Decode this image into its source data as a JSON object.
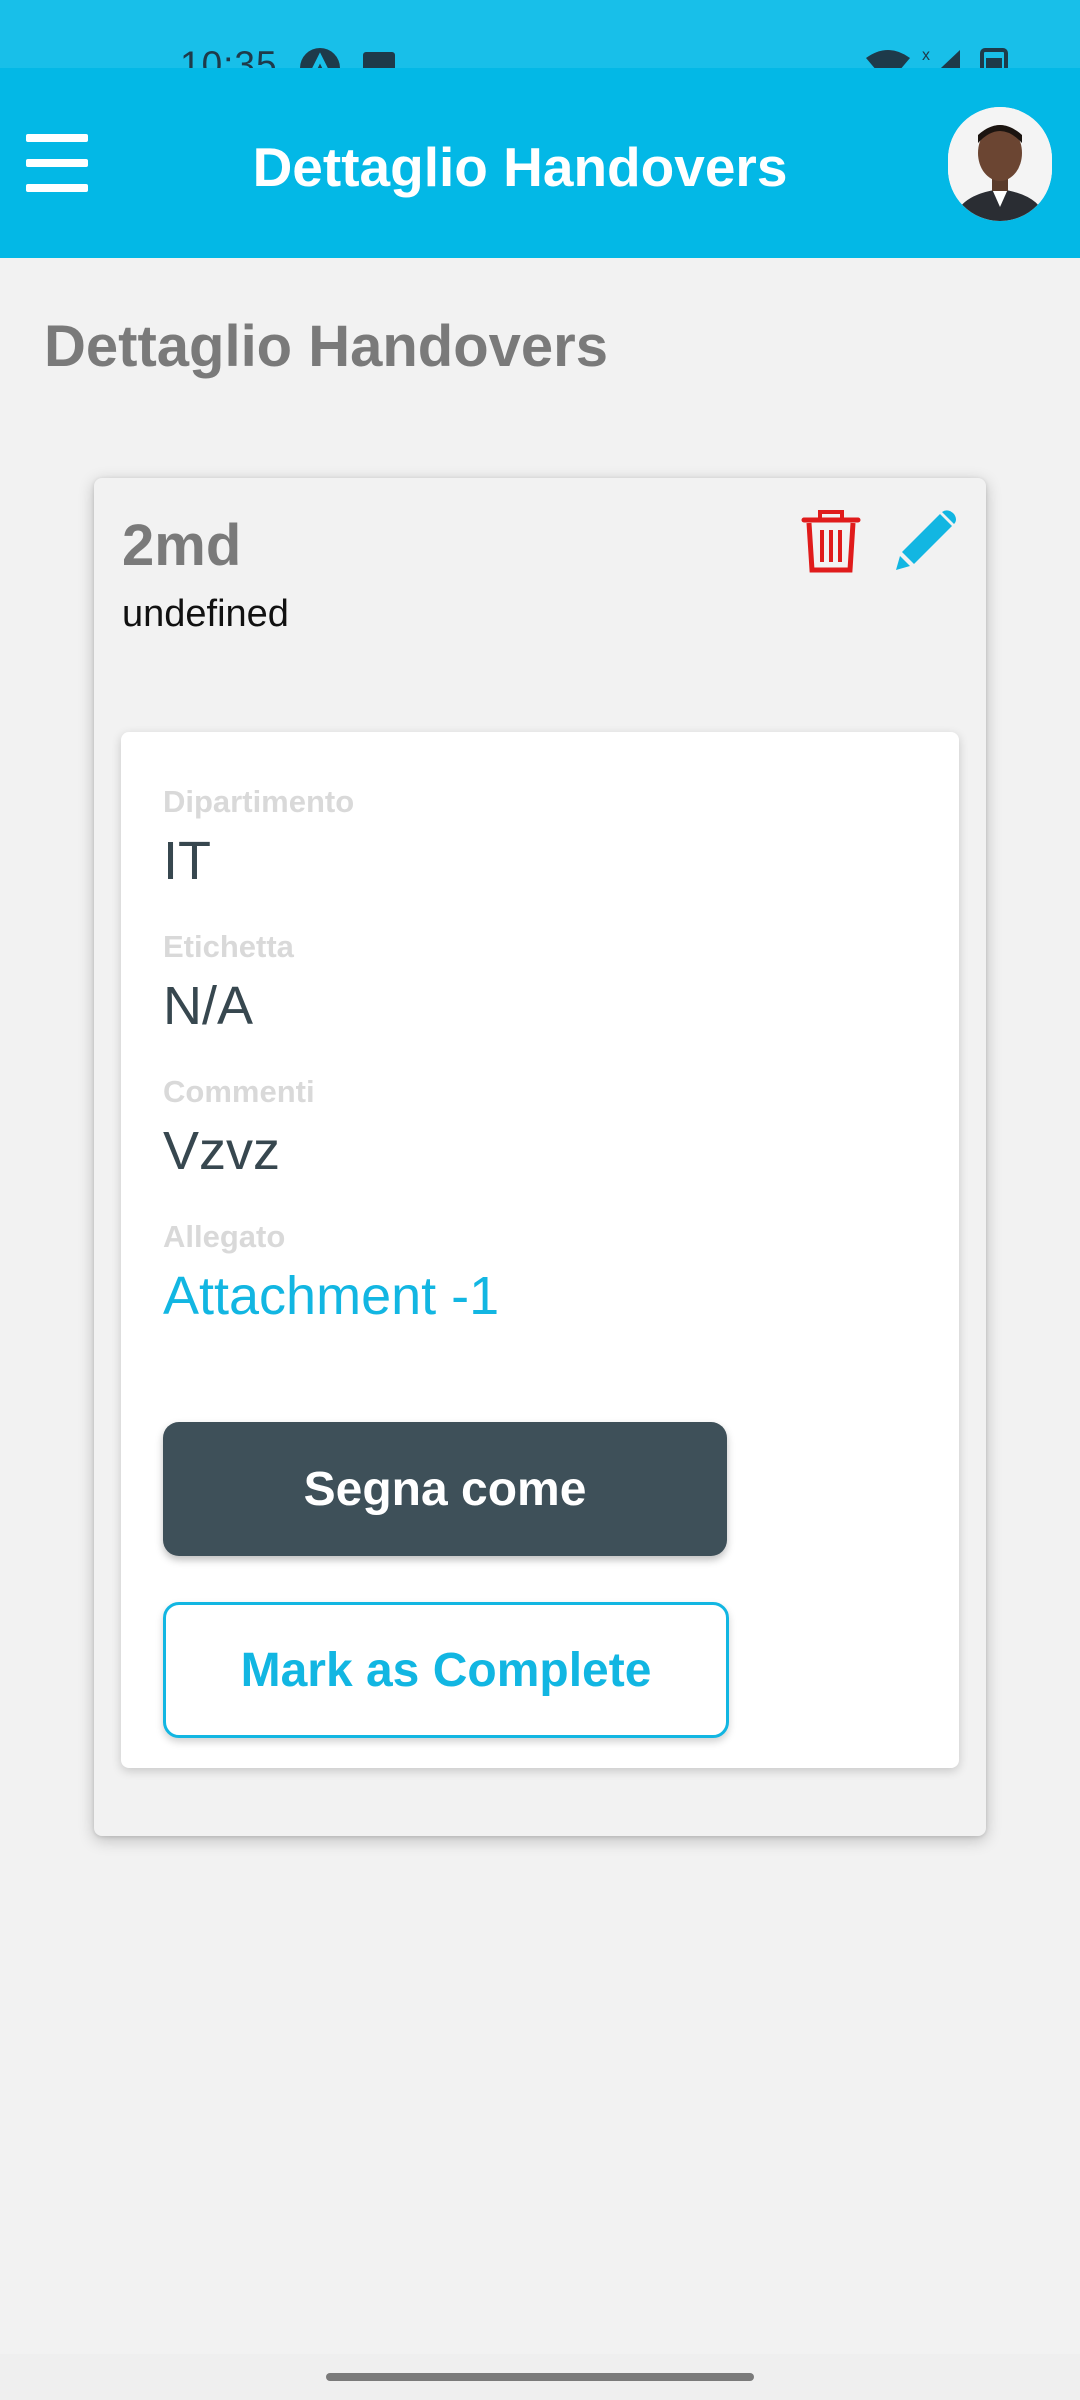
{
  "status_bar": {
    "time": "10:35",
    "icons": [
      "app-notification-icon",
      "image-notification-icon",
      "wifi-icon",
      "signal-icon",
      "battery-icon"
    ]
  },
  "app_bar": {
    "title": "Dettaglio Handovers",
    "menu_icon": "hamburger-menu-icon",
    "avatar": "user-avatar"
  },
  "page": {
    "title": "Dettaglio Handovers"
  },
  "handover": {
    "name": "2md",
    "subtitle": "undefined",
    "fields": [
      {
        "label": "Dipartimento",
        "value": "IT"
      },
      {
        "label": "Etichetta",
        "value": "N/A"
      },
      {
        "label": "Commenti",
        "value": "Vzvz"
      },
      {
        "label": "Allegato",
        "value": "Attachment -1"
      }
    ],
    "actions": {
      "delete_icon": "trash-icon",
      "edit_icon": "pencil-icon",
      "mark_button": "Segna come",
      "complete_button": "Mark as Complete"
    }
  },
  "colors": {
    "primary": "#03b8e6",
    "dark_button": "#3e5059",
    "delete": "#e01b1b",
    "edit": "#12b6e2"
  }
}
